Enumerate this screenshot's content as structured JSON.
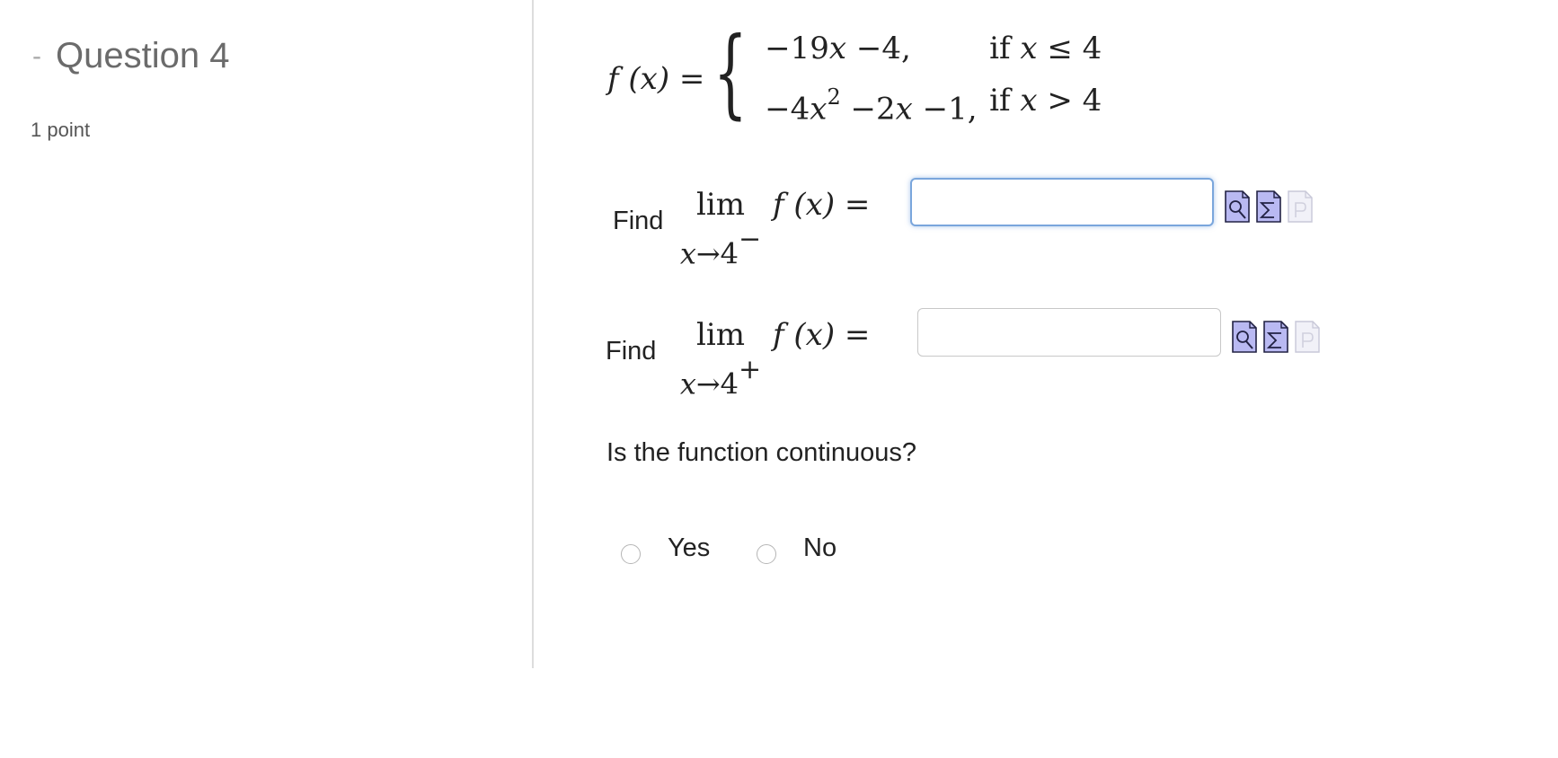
{
  "question": {
    "collapse_symbol": "-",
    "title": "Question 4",
    "points": "1 point"
  },
  "definition": {
    "lhs": "f (x) =",
    "cases": [
      {
        "expr_a": "−19",
        "expr_var": "x",
        "expr_b": " −4,",
        "cond_if": "if ",
        "cond_var": "x",
        "cond_rest": " ≤ 4"
      },
      {
        "expr_a": "−4",
        "expr_var": "x",
        "expr_sup": "2",
        "expr_b": " −2",
        "expr_var2": "x",
        "expr_c": " −1,",
        "cond_if": "if ",
        "cond_var": "x",
        "cond_rest": " > 4"
      }
    ]
  },
  "limit_left": {
    "label": "Find",
    "lim": "lim",
    "sub_var": "x",
    "sub_arrow": "→4",
    "sub_side": "−",
    "fx": "f (x) =",
    "input_value": ""
  },
  "limit_right": {
    "label": "Find",
    "lim": "lim",
    "sub_var": "x",
    "sub_arrow": "→4",
    "sub_side": "+",
    "fx": "f (x) =",
    "input_value": ""
  },
  "tool_icons": [
    "preview-icon",
    "equation-editor-icon",
    "formula-icon-disabled"
  ],
  "continuity": {
    "question": "Is the function continuous?",
    "options": [
      "Yes",
      "No"
    ]
  },
  "colors": {
    "icon_fill": "#b9b9f2",
    "icon_border": "#222244",
    "focus_border": "#7aa6dc",
    "divider": "#dddddd"
  }
}
